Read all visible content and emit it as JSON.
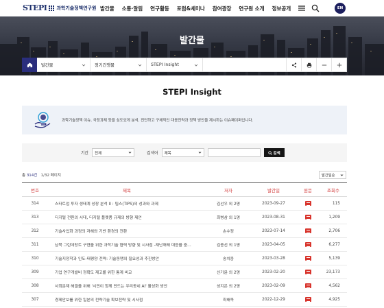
{
  "header": {
    "logo_mark": "STEPI",
    "logo_text": "과학기술정책연구원",
    "nav": [
      "발간물",
      "소통·알림",
      "연구활동",
      "포럼&세미나",
      "참여광장",
      "연구원 소개",
      "정보공개"
    ],
    "lang": "EN"
  },
  "hero": {
    "title": "발간물"
  },
  "subnav": {
    "crumbs": [
      "발간물",
      "정기간행물",
      "STEPI Insight"
    ]
  },
  "page_title": "STEPI Insight",
  "intro": {
    "text": "과학기술정책 이슈, 국정과제 등을 심도있게 분석, 진단하고 구체적인 대응전략과 정책 방안을 제시하는 이슈페이퍼입니다."
  },
  "search": {
    "period_label": "기간",
    "period_value": "전체",
    "field_label": "검색어",
    "field_value": "제목",
    "keyword": "",
    "button": "검색"
  },
  "list": {
    "count_prefix": "총 ",
    "count_value": "314건",
    "pages": "1/32 페이지",
    "sort": "발간일순",
    "columns": [
      "번호",
      "제목",
      "저자",
      "발간일",
      "원문",
      "조회수"
    ],
    "rows": [
      {
        "no": "314",
        "title": "스타트업 투자 생태계 성장 분석 II : 팁스(TIPS)의 성과와 과제",
        "author": "김선우 외 2명",
        "date": "2023-09-27",
        "views": "115"
      },
      {
        "no": "313",
        "title": "디지털 전환의 시대, 디지털 플랫폼 규제의 방향 제언",
        "author": "최병삼 외 1명",
        "date": "2023-08-31",
        "views": "1,209"
      },
      {
        "no": "312",
        "title": "기술사업화 과정의 저해와 기반 환경의 전환",
        "author": "손수정",
        "date": "2023-07-14",
        "views": "2,706"
      },
      {
        "no": "311",
        "title": "남북 그린데탕트 구현을 위한 과학기술 협력 방향 및 시사점 -재난재해 대응을 중…",
        "author": "김종선 외 1명",
        "date": "2023-04-05",
        "views": "6,277"
      },
      {
        "no": "310",
        "title": "기술지정학과 인도-태평양 전략: 기술동맹의 필요성과 추진방안",
        "author": "송치웅",
        "date": "2023-03-28",
        "views": "5,139"
      },
      {
        "no": "309",
        "title": "기업 연구개발비 정확도 제고를 위한 통계 비교",
        "author": "신가윤 외 2명",
        "date": "2023-02-20",
        "views": "23,173"
      },
      {
        "no": "308",
        "title": "사회문제 해결을 위해 '시민이 함께 만드는 우리동네 AI' 활성화 방안",
        "author": "성지은 외 2명",
        "date": "2023-02-09",
        "views": "4,562"
      },
      {
        "no": "307",
        "title": "경제안보를 위한 일본의 전략기술 확보전략 및 시사점",
        "author": "최해옥",
        "date": "2022-12-29",
        "views": "4,925"
      }
    ]
  }
}
